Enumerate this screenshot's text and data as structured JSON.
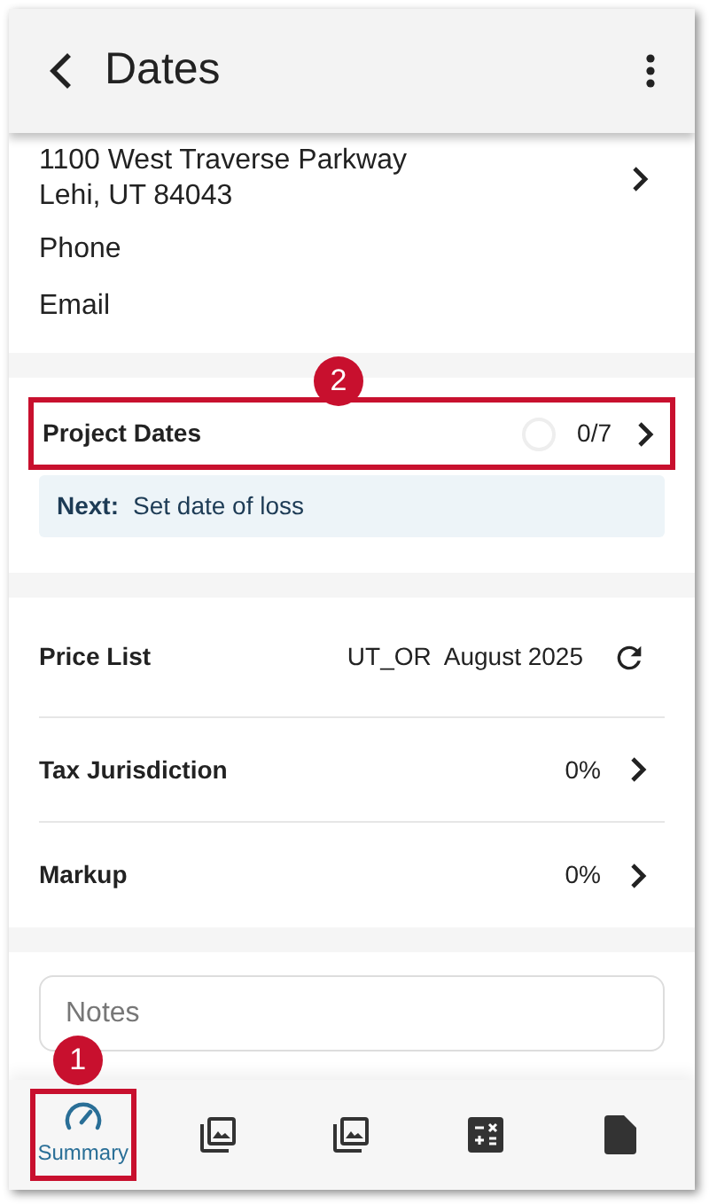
{
  "header": {
    "title": "Dates"
  },
  "address": {
    "lines": [
      "1100 West Traverse Parkway",
      "Lehi, UT 84043"
    ],
    "phone": "Phone",
    "email": "Email"
  },
  "project_dates": {
    "label": "Project Dates",
    "count": "0/7",
    "highlighted": true,
    "callout": "2",
    "next_label": "Next:",
    "next_text": "Set date of loss"
  },
  "settings": [
    {
      "label": "Price List",
      "value": "UT_OR  August 2025",
      "kind": "refresh"
    },
    {
      "label": "Tax Jurisdiction",
      "value": "0%",
      "kind": "chevron"
    },
    {
      "label": "Markup",
      "value": "0%",
      "kind": "chevron"
    }
  ],
  "notes": {
    "placeholder": "Notes"
  },
  "tabs": [
    {
      "kind": "gauge",
      "label": "Summary",
      "selected": true,
      "highlighted": true,
      "callout": "1"
    },
    {
      "kind": "photos",
      "selected": false,
      "highlighted": false
    },
    {
      "kind": "photos",
      "selected": false,
      "highlighted": false
    },
    {
      "kind": "calculator",
      "selected": false,
      "highlighted": false
    },
    {
      "kind": "document",
      "selected": false,
      "highlighted": false
    }
  ]
}
